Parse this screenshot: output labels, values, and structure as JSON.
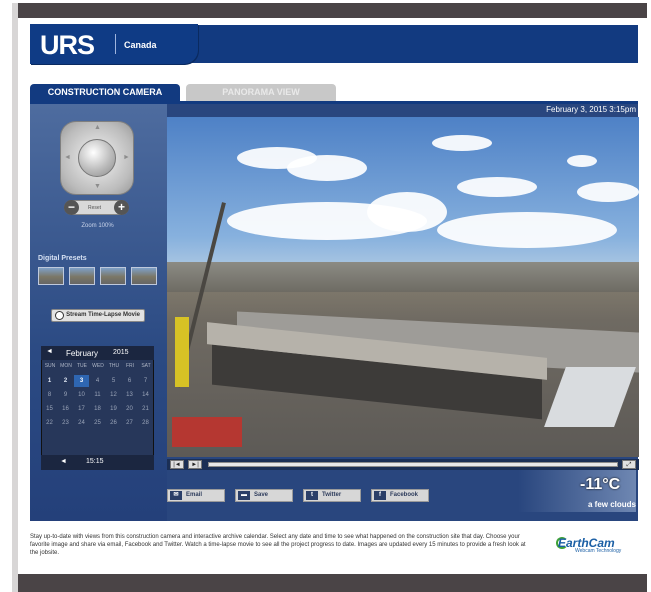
{
  "header": {
    "logo_text": "URS",
    "logo_sub": "Canada"
  },
  "tabs": [
    {
      "label": "CONSTRUCTION CAMERA",
      "active": true
    },
    {
      "label": "PANORAMA VIEW",
      "active": false
    }
  ],
  "camera": {
    "timestamp": "February 3, 2015 3:15pm"
  },
  "controls": {
    "zoom_label": "Zoom 100%",
    "zoom_center": "Reset",
    "zoom_minus": "−",
    "zoom_plus": "+"
  },
  "presets": {
    "title": "Digital Presets",
    "count": 4
  },
  "stream_button": "Stream Time-Lapse Movie",
  "calendar": {
    "prev": "◄",
    "month": "February",
    "year": "2015",
    "days_of_week": [
      "SUN",
      "MON",
      "TUE",
      "WED",
      "THU",
      "FRI",
      "SAT"
    ],
    "weeks": [
      [
        "1",
        "2",
        "3",
        "4",
        "5",
        "6",
        "7"
      ],
      [
        "8",
        "9",
        "10",
        "11",
        "12",
        "13",
        "14"
      ],
      [
        "15",
        "16",
        "17",
        "18",
        "19",
        "20",
        "21"
      ],
      [
        "22",
        "23",
        "24",
        "25",
        "26",
        "27",
        "28"
      ]
    ],
    "available_days": [
      "1",
      "2"
    ],
    "selected_day": "3",
    "footer_arrow": "◄",
    "time": "15:15"
  },
  "player": {
    "rewind": "|◄",
    "play": "►|",
    "fullscreen": "⤢"
  },
  "share": [
    {
      "label": "Email",
      "icon": "envelope-icon",
      "glyph": "✉"
    },
    {
      "label": "Save",
      "icon": "folder-icon",
      "glyph": "▬"
    },
    {
      "label": "Twitter",
      "icon": "twitter-icon",
      "glyph": "t"
    },
    {
      "label": "Facebook",
      "icon": "facebook-icon",
      "glyph": "f"
    }
  ],
  "weather": {
    "temperature": "-11°C",
    "condition": "a few clouds"
  },
  "description": "Stay up-to-date with views from this construction camera and interactive archive calendar. Select any date and time to see what happened on the construction site that day. Choose your favorite image and share via email, Facebook and Twitter. Watch a time-lapse movie to see all the project progress to date. Images are updated every 15 minutes to provide a fresh look at the jobsite.",
  "branding": {
    "name": "EarthCam",
    "sub": "Webcam Technology"
  },
  "colors": {
    "brand_blue": "#123a80",
    "panel_blue": "#29467e",
    "selected_day": "#2e66b2"
  }
}
